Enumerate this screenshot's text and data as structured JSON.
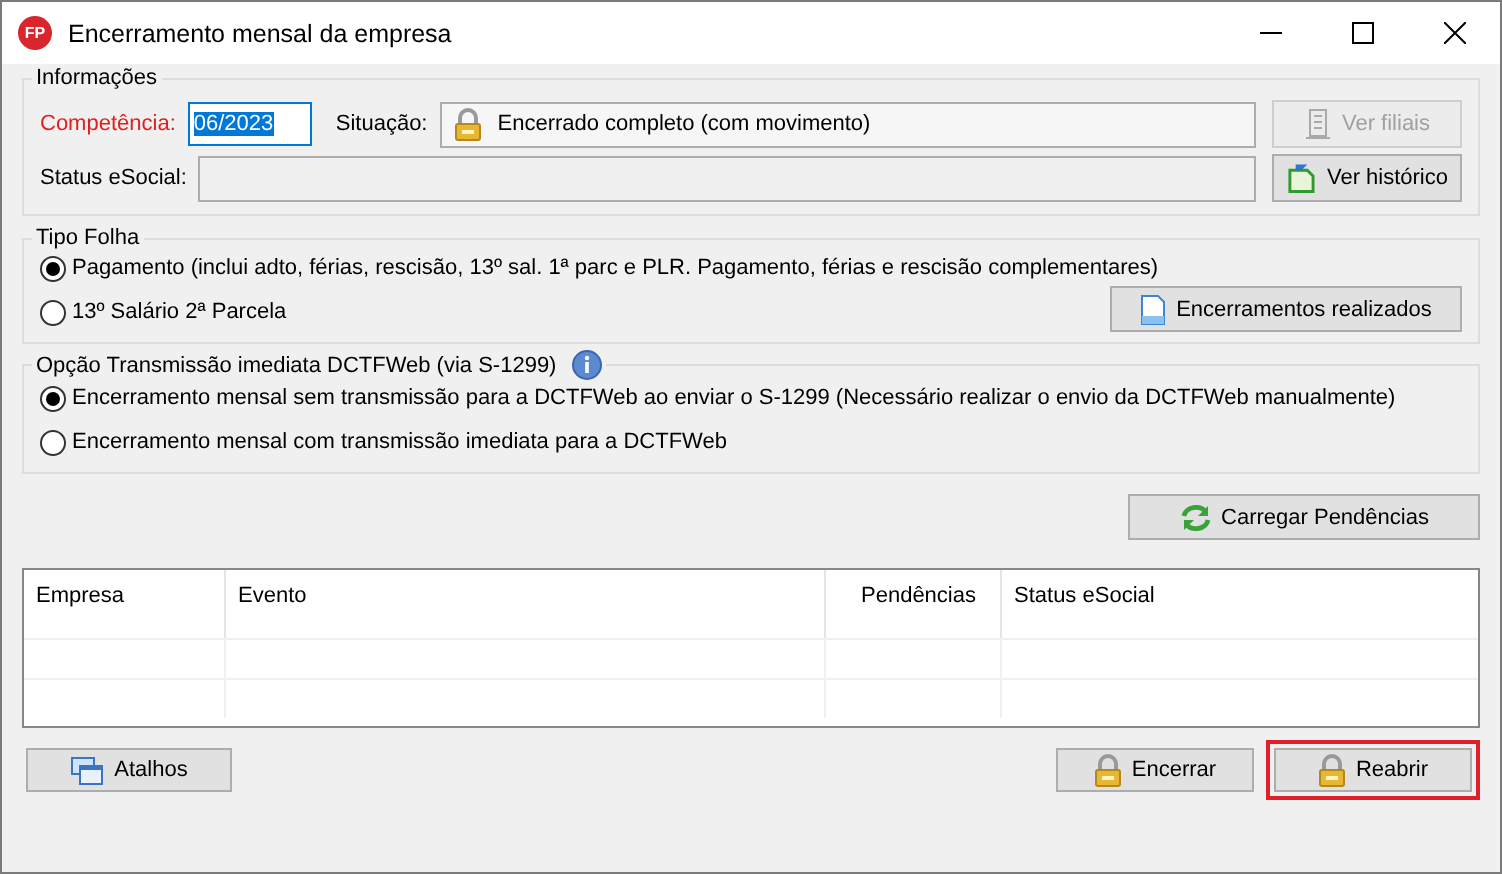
{
  "window": {
    "title": "Encerramento mensal da empresa",
    "logo": "FP"
  },
  "informacoes": {
    "title": "Informações",
    "competencia": {
      "label": "Competência:",
      "value": "06/2023"
    },
    "situacao": {
      "label": "Situação:",
      "value": "Encerrado completo (com movimento)"
    },
    "status_esocial": {
      "label": "Status eSocial:"
    },
    "buttons": [
      {
        "label": "Ver filiais",
        "disabled": true,
        "kind": "building"
      },
      {
        "label": "Ver histórico",
        "disabled": false,
        "kind": "history"
      }
    ]
  },
  "tipo_folha": {
    "title": "Tipo Folha",
    "options": [
      {
        "label": "Pagamento (inclui adto, férias, rescisão, 13º sal. 1ª parc e PLR. Pagamento, férias e rescisão complementares)",
        "selected": true
      },
      {
        "label": "13º Salário 2ª Parcela",
        "selected": false
      }
    ],
    "button": {
      "label": "Encerramentos realizados"
    }
  },
  "transmissao": {
    "title": "Opção Transmissão imediata DCTFWeb (via S-1299)",
    "options": [
      {
        "label": "Encerramento mensal sem transmissão para a DCTFWeb ao enviar o S-1299 (Necessário realizar o envio da DCTFWeb manualmente)",
        "selected": true
      },
      {
        "label": "Encerramento mensal com transmissão imediata para a DCTFWeb",
        "selected": false
      }
    ]
  },
  "carregar_button": {
    "label": "Carregar Pendências"
  },
  "table": {
    "columns": [
      "Empresa",
      "Evento",
      "Pendências",
      "Status eSocial"
    ]
  },
  "footer": {
    "buttons": [
      {
        "label": "Atalhos",
        "kind": "shortcuts",
        "highlighted": false
      },
      {
        "label": "Encerrar",
        "kind": "lock",
        "highlighted": false
      },
      {
        "label": "Reabrir",
        "kind": "lock",
        "highlighted": true
      }
    ]
  }
}
